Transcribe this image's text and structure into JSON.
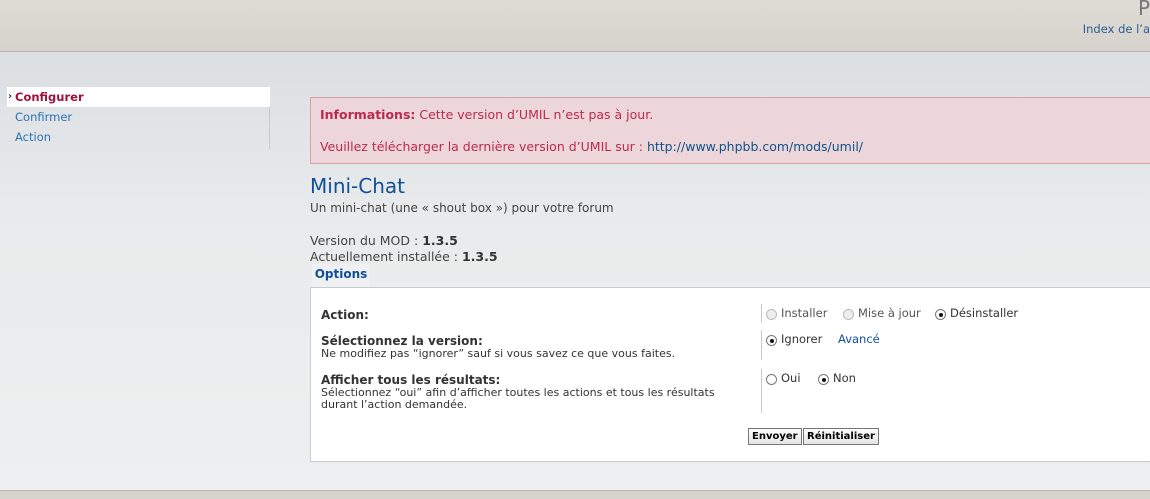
{
  "header": {
    "logo_char": "P",
    "index_link": "Index de l’a"
  },
  "sidebar": {
    "items": [
      {
        "label": "Configurer",
        "active": true
      },
      {
        "label": "Confirmer",
        "active": false
      },
      {
        "label": "Action",
        "active": false
      }
    ]
  },
  "error": {
    "label": "Informations:",
    "message": "Cette version d’UMIL n’est pas à jour.",
    "download_text": "Veuillez télécharger la dernière version d’UMIL sur :",
    "url": "http://www.phpbb.com/mods/umil/"
  },
  "mod": {
    "title": "Mini-Chat",
    "subtitle": "Un mini-chat (une « shout box ») pour votre forum",
    "version_label": "Version du MOD :",
    "version_value": "1.3.5",
    "installed_label": "Actuellement installée :",
    "installed_value": "1.3.5"
  },
  "tab": {
    "label": "Options"
  },
  "form": {
    "action": {
      "label": "Action:",
      "options": [
        {
          "label": "Installer",
          "checked": false,
          "disabled": true
        },
        {
          "label": "Mise à jour",
          "checked": false,
          "disabled": true
        },
        {
          "label": "Désinstaller",
          "checked": true,
          "disabled": false
        }
      ]
    },
    "version": {
      "label": "Sélectionnez la version:",
      "description": "Ne modifiez pas “ignorer” sauf si vous savez ce que vous faites.",
      "option_label": "Ignorer",
      "advanced_link": "Avancé"
    },
    "results": {
      "label": "Afficher tous les résultats:",
      "description_1": "Sélectionnez “oui” afin d’afficher toutes les actions et tous les résultats",
      "description_2": "durant l’action demandée.",
      "options": [
        {
          "label": "Oui",
          "checked": false
        },
        {
          "label": "Non",
          "checked": true
        }
      ]
    },
    "submit_label": "Envoyer",
    "reset_label": "Réinitialiser"
  }
}
